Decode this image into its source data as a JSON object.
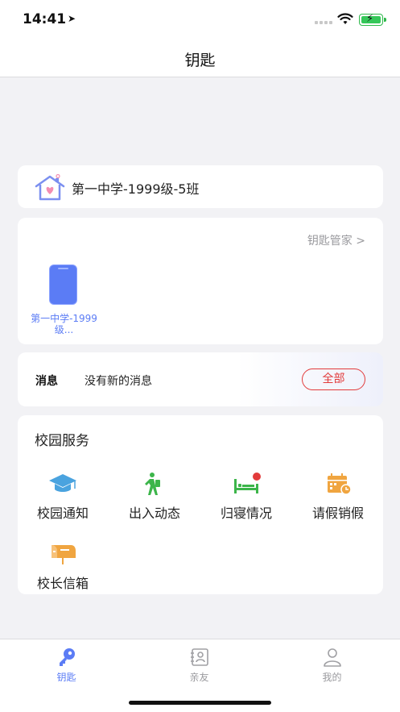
{
  "status_bar": {
    "time": "14:41"
  },
  "nav": {
    "title": "钥匙"
  },
  "class_card": {
    "name": "第一中学-1999级-5班",
    "icon": "house-heart-icon"
  },
  "key_card": {
    "manager_link": "钥匙管家 >",
    "keys": [
      {
        "label": "第一中学-1999级...",
        "icon": "phone-key-icon"
      }
    ]
  },
  "messages": {
    "label": "消息",
    "text": "没有新的消息",
    "all_button": "全部"
  },
  "services": {
    "title": "校园服务",
    "items": [
      {
        "label": "校园通知",
        "icon": "graduation-cap-icon",
        "color": "#4aa3df"
      },
      {
        "label": "出入动态",
        "icon": "walking-person-icon",
        "color": "#3cb54a"
      },
      {
        "label": "归寝情况",
        "icon": "bed-icon",
        "color": "#3cb54a"
      },
      {
        "label": "请假销假",
        "icon": "calendar-clock-icon",
        "color": "#f0a540"
      },
      {
        "label": "校长信箱",
        "icon": "mailbox-icon",
        "color": "#f0a540"
      }
    ]
  },
  "tabs": [
    {
      "label": "钥匙",
      "icon": "key-icon",
      "active": true
    },
    {
      "label": "亲友",
      "icon": "contacts-icon",
      "active": false
    },
    {
      "label": "我的",
      "icon": "person-icon",
      "active": false
    }
  ],
  "colors": {
    "accent": "#5b7cf5",
    "danger": "#e23b3b",
    "background": "#f2f2f5"
  }
}
